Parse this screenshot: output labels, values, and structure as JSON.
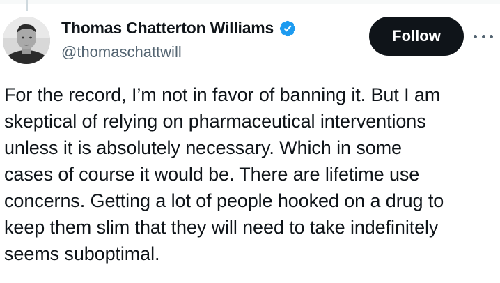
{
  "author": {
    "display_name": "Thomas Chatterton Williams",
    "handle": "@thomaschattwill",
    "verified": true
  },
  "actions": {
    "follow_label": "Follow",
    "more_icon": "more-horizontal-icon"
  },
  "tweet": {
    "lines": [
      "For the record, I’m not in favor of banning it. But I am",
      "skeptical of relying on pharmaceutical interventions",
      "unless it is absolutely necessary. Which in some",
      "cases of course it would be. There are lifetime use",
      "concerns. Getting a lot of people hooked on a drug to",
      "keep them slim that they will need to take indefinitely",
      "seems suboptimal."
    ]
  },
  "colors": {
    "text_primary": "#0f1419",
    "text_secondary": "#536471",
    "follow_bg": "#0f1419",
    "verified_badge": "#1d9bf0"
  }
}
